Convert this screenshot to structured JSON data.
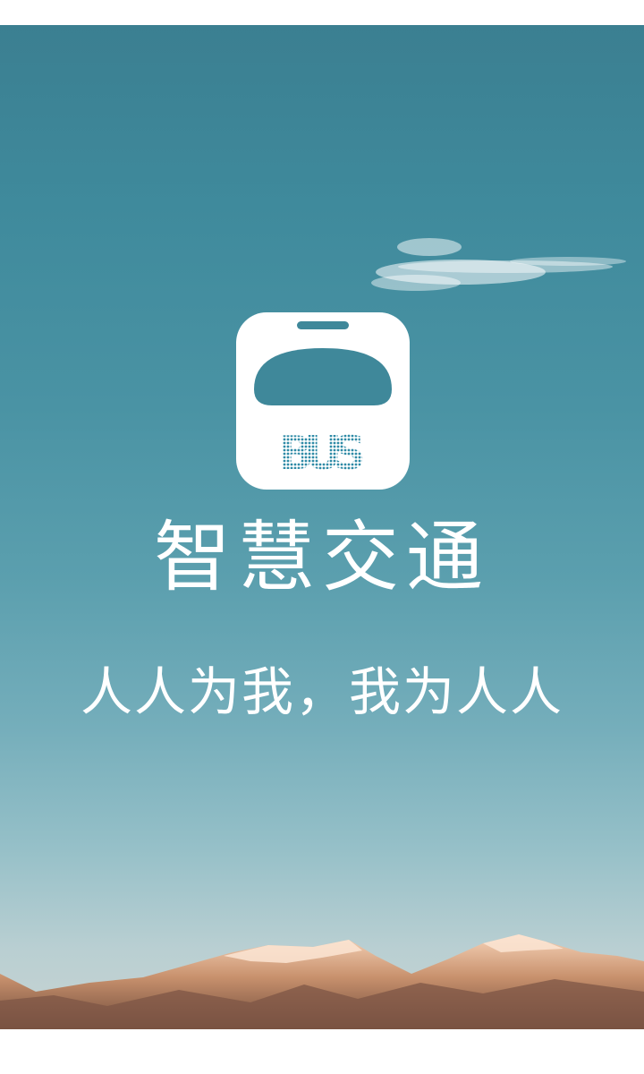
{
  "app": {
    "title": "智慧交通",
    "slogan": "人人为我，我为人人"
  },
  "logo": {
    "icon": "bus-icon",
    "text": "BUS"
  },
  "colors": {
    "sky_top": "#3b7f91",
    "sky_bottom": "#c8d3d2",
    "logo_bg": "#ffffff",
    "logo_window": "#3f889a",
    "text": "#ffffff"
  }
}
